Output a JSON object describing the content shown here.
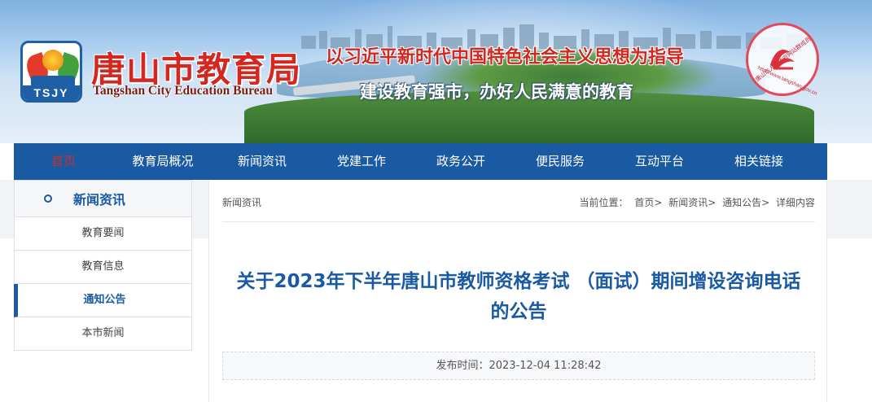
{
  "header": {
    "logo_text": "TSJY",
    "site_title": "唐山市教育局",
    "site_subtitle": "Tangshan City Education Bureau",
    "slogan_primary": "以习近平新时代中国特色社会主义思想为指导",
    "slogan_secondary": "建设教育强市，办好人民满意的教育",
    "seal": {
      "text": "唐山市人民政府网站群成员",
      "url": "http://www.tangshan.gov.cn"
    }
  },
  "nav": {
    "items": [
      {
        "label": "首页"
      },
      {
        "label": "教育局概况"
      },
      {
        "label": "新闻资讯"
      },
      {
        "label": "党建工作"
      },
      {
        "label": "政务公开"
      },
      {
        "label": "便民服务"
      },
      {
        "label": "互动平台"
      },
      {
        "label": "相关链接"
      }
    ]
  },
  "sidebar": {
    "title": "新闻资讯",
    "items": [
      {
        "label": "教育要闻"
      },
      {
        "label": "教育信息"
      },
      {
        "label": "通知公告"
      },
      {
        "label": "本市新闻"
      }
    ]
  },
  "main": {
    "section_label": "新闻资讯",
    "breadcrumb": {
      "prefix": "当前位置：",
      "items": [
        "首页>",
        "新闻资讯>",
        "通知公告>",
        "详细内容"
      ]
    },
    "article": {
      "title_line1": "关于2023年下半年唐山市教师资格考试 （面试）期间增设咨询电话",
      "title_line2": "的公告",
      "publish_label": "发布时间：",
      "publish_time": "2023-12-04 11:28:42"
    }
  },
  "colors": {
    "nav_bg": "#1a5aa3",
    "accent_red": "#d4271f",
    "title_blue": "#1a5aa3"
  }
}
